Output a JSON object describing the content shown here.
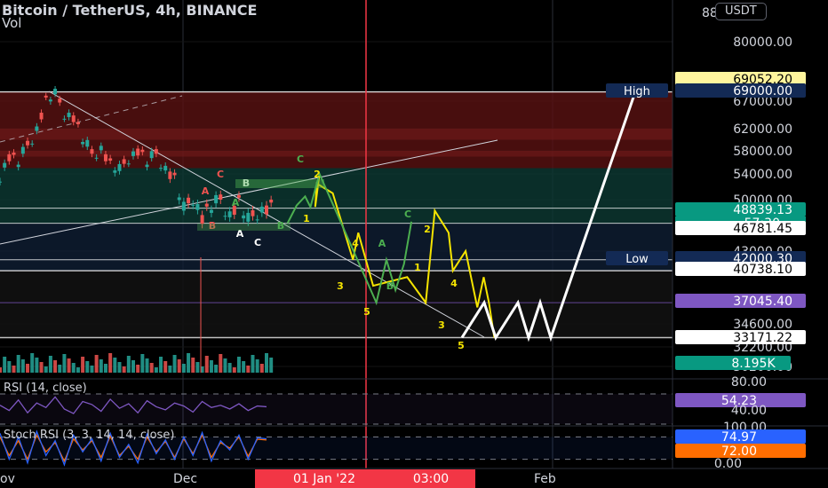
{
  "header": {
    "title": "Bitcoin / TetherUS, 4h, BINANCE",
    "vol_label": "Vol",
    "currency_button": "USDT",
    "top_scale_label": "88"
  },
  "colors": {
    "background": "#000000",
    "grid": "#2a2e39",
    "bull_candle": "#26a69a",
    "bear_candle": "#ef5350",
    "red_zone": "#5a1212",
    "green_zone": "#0d3a33",
    "blue_zone": "#0f1e33",
    "wave_yellow": "#f5e400",
    "wave_green": "#4caf50",
    "projection": "#ffffff",
    "rsi_line": "#7e57c2",
    "stoch_k": "#2962ff",
    "stoch_d": "#ff6d00",
    "time_marker": "#f23645",
    "level_purple": "#7e57c2",
    "price_tag_teal": "#089981",
    "tag_navy": "#132a55",
    "tag_yellow": "#fff59d"
  },
  "chart_data": {
    "type": "line",
    "title": "Bitcoin / TetherUS, 4h, BINANCE",
    "symbol": "BTCUSDT",
    "timeframe": "4h",
    "exchange": "BINANCE",
    "price_axis_labels": [
      "80000.00",
      "67000.00",
      "62000.00",
      "58000.00",
      "54000.00",
      "50000.00",
      "43000.00",
      "34600.00",
      "32200.00",
      "30200.00"
    ],
    "price_axis_range": [
      29500,
      87000
    ],
    "time_axis_labels": [
      "ov",
      "Dec",
      "01 Jan '22",
      "03:00",
      "Feb"
    ],
    "horizontal_levels": [
      69052.2,
      69000,
      48839.13,
      46781.45,
      42000.3,
      40738.1,
      37045.4,
      33171.22
    ],
    "zones": [
      {
        "name": "red-zone",
        "from": 55000,
        "to": 69000
      },
      {
        "name": "green-zone",
        "from": 46781.45,
        "to": 55000
      },
      {
        "name": "blue-zone",
        "from": 40738.1,
        "to": 46781.45
      }
    ],
    "price_tags": [
      {
        "text": "69052.20",
        "price": 69052.2,
        "style": "yellow"
      },
      {
        "text": "69000.00",
        "price": 69000,
        "style": "navy",
        "label": "High"
      },
      {
        "text": "48839.13",
        "price": 48839.13,
        "style": "teal",
        "sub": "57:30"
      },
      {
        "text": "46781.45",
        "price": 46781.45,
        "style": "white"
      },
      {
        "text": "42000.30",
        "price": 42000.3,
        "style": "navy",
        "label": "Low"
      },
      {
        "text": "40738.10",
        "price": 40738.1,
        "style": "white"
      },
      {
        "text": "37045.40",
        "price": 37045.4,
        "style": "purple"
      },
      {
        "text": "33171.22",
        "price": 33171.22,
        "style": "white"
      }
    ],
    "volume_tag": "8.195K",
    "price_history": [
      54000,
      57000,
      56000,
      59000,
      62000,
      67000,
      68500,
      65000,
      64000,
      60000,
      57500,
      58500,
      55500,
      54500,
      57000,
      58000,
      56000,
      57500,
      55000,
      53000,
      48500,
      50500,
      47500,
      49000,
      50000,
      48000,
      49500,
      47000,
      48500,
      48800
    ],
    "wave_yellow": [
      [
        52500,
        54000
      ],
      [
        51700,
        49000
      ],
      [
        52000,
        52500
      ],
      [
        55000,
        51000
      ],
      [
        58800,
        42000
      ],
      [
        59800,
        45500
      ],
      [
        62600,
        39000
      ],
      [
        69000,
        40000
      ],
      [
        72500,
        37045
      ],
      [
        74200,
        48500
      ],
      [
        76800,
        45500
      ],
      [
        77600,
        40738
      ],
      [
        80000,
        43000
      ],
      [
        82200,
        36500
      ],
      [
        83400,
        40000
      ],
      [
        84400,
        37000
      ],
      [
        85400,
        33171
      ]
    ],
    "wave_green": [
      [
        46500,
        46800
      ],
      [
        48200,
        49200
      ],
      [
        49800,
        50500
      ],
      [
        50800,
        49000
      ],
      [
        52500,
        54000
      ],
      [
        63200,
        37045
      ],
      [
        65100,
        42000
      ],
      [
        66800,
        38500
      ],
      [
        68400,
        41500
      ],
      [
        69800,
        47000
      ]
    ],
    "wave_labels": [
      {
        "text": "C",
        "color": "wave_green"
      },
      {
        "text": "2",
        "color": "wave_yellow"
      },
      {
        "text": "1",
        "color": "wave_yellow"
      },
      {
        "text": "4",
        "color": "wave_yellow"
      },
      {
        "text": "A",
        "color": "wave_green"
      },
      {
        "text": "3",
        "color": "wave_yellow"
      },
      {
        "text": "B",
        "color": "wave_green"
      },
      {
        "text": "5",
        "color": "wave_yellow"
      },
      {
        "text": "C",
        "color": "wave_green"
      },
      {
        "text": "2",
        "color": "wave_yellow"
      },
      {
        "text": "1",
        "color": "wave_yellow"
      },
      {
        "text": "4",
        "color": "wave_yellow"
      },
      {
        "text": "3",
        "color": "wave_yellow"
      },
      {
        "text": "5",
        "color": "wave_yellow"
      },
      {
        "text": "C",
        "color": "bear_candle"
      },
      {
        "text": "A",
        "color": "bear_candle"
      },
      {
        "text": "B",
        "color": "bear_candle"
      },
      {
        "text": "B",
        "color": "projection"
      },
      {
        "text": "A",
        "color": "projection"
      },
      {
        "text": "C",
        "color": "projection"
      },
      {
        "text": "A",
        "color": "wave_green"
      },
      {
        "text": "B",
        "color": "wave_green"
      }
    ],
    "projection": [
      33171.22,
      37045.4,
      33171.22,
      37045.4,
      33171.22,
      37045.4,
      33171.22,
      69000
    ],
    "rsi": {
      "label": "RSI (14, close)",
      "value_tag": "54.23",
      "axis_labels": [
        "80.00",
        "40.00"
      ],
      "range": [
        30,
        90
      ],
      "values": [
        55,
        48,
        62,
        45,
        58,
        52,
        66,
        50,
        44,
        60,
        56,
        47,
        63,
        51,
        57,
        45,
        61,
        53,
        49,
        58,
        54,
        46,
        60,
        52,
        55,
        50,
        57,
        48,
        54,
        53
      ]
    },
    "stoch_rsi": {
      "label": "Stoch RSI (3, 3, 14, 14, close)",
      "k_tag": "74.97",
      "d_tag": "72.00",
      "axis_labels": [
        "100.00",
        "0.00"
      ],
      "range": [
        -5,
        110
      ],
      "k": [
        90,
        20,
        80,
        10,
        95,
        30,
        70,
        5,
        85,
        40,
        75,
        15,
        90,
        25,
        60,
        10,
        88,
        35,
        72,
        20,
        80,
        30,
        92,
        15,
        70,
        45,
        85,
        20,
        78,
        75
      ],
      "d": [
        80,
        30,
        70,
        20,
        85,
        40,
        65,
        15,
        75,
        45,
        70,
        25,
        82,
        30,
        55,
        20,
        80,
        40,
        68,
        25,
        75,
        35,
        85,
        25,
        65,
        50,
        80,
        28,
        74,
        72
      ]
    }
  }
}
